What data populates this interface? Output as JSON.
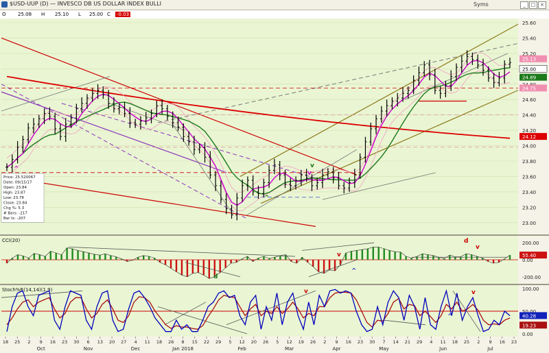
{
  "window": {
    "title": "$USD-UUP (D) — INVESCO DB US DOLLAR INDEX BULLI",
    "brand": "Syms"
  },
  "quote_bar": {
    "items": [
      "O",
      "25.08",
      "H",
      "25.10",
      "L",
      "25.00",
      "C",
      "-0.03"
    ]
  },
  "info_box": [
    "Price: 25.520067",
    "Date: 09/15/17",
    "Open: 23.84",
    "High: 23.87",
    "Low: 23.78",
    "Close: 23.84",
    "Chg %: 5.3",
    "# Bars: -217",
    "Bar Ix: -207"
  ],
  "colors": {
    "price_bg": "#eaf5d3",
    "bar": "#000000",
    "ma_fast": "#cc00cc",
    "ma_mid": "#1b7a1b",
    "ma_slow": "#dd0000",
    "channel": "#8c7a1a",
    "trend_gray": "#707070",
    "dash_purple": "#8833bb",
    "cci_pos": "#1f8a1f",
    "cci_neg": "#cc1111",
    "stoch_k": "#0000bb",
    "stoch_d": "#aa1111"
  },
  "chart_data": [
    {
      "type": "ohlc",
      "series": [
        {
          "name": "UUP",
          "values": [
            23.72,
            23.82,
            23.98,
            24.08,
            24.23,
            24.28,
            24.35,
            24.42,
            24.38,
            24.22,
            24.12,
            24.28,
            24.36,
            24.48,
            24.55,
            24.62,
            24.68,
            24.72,
            24.66,
            24.55,
            24.48,
            24.5,
            24.42,
            24.3,
            24.28,
            24.32,
            24.36,
            24.42,
            24.52,
            24.48,
            24.38,
            24.3,
            24.24,
            24.12,
            24.05,
            23.95,
            23.98,
            23.85,
            23.62,
            23.48,
            23.3,
            23.18,
            23.1,
            23.32,
            23.48,
            23.55,
            23.4,
            23.38,
            23.52,
            23.68,
            23.75,
            23.62,
            23.5,
            23.48,
            23.55,
            23.62,
            23.58,
            23.48,
            23.52,
            23.62,
            23.66,
            23.58,
            23.48,
            23.45,
            23.52,
            23.62,
            23.85,
            24.05,
            24.22,
            24.35,
            24.45,
            24.52,
            24.58,
            24.62,
            24.68,
            24.72,
            24.85,
            24.95,
            25.05,
            24.92,
            24.72,
            24.68,
            24.78,
            24.9,
            25.02,
            25.1,
            25.16,
            25.12,
            25.05,
            24.98,
            24.88,
            24.82,
            24.88,
            25.06,
            25.08
          ]
        }
      ],
      "last_close": 25.06,
      "ylim": [
        22.9,
        25.6
      ],
      "yticks": [
        "25.60",
        "25.40",
        "25.20",
        "25.00",
        "24.80",
        "24.60",
        "24.40",
        "24.20",
        "24.00",
        "23.80",
        "23.60",
        "23.40",
        "23.20",
        "23.00"
      ],
      "price_labels": [
        {
          "text": "25.13",
          "color": "#f08fb0"
        },
        {
          "text": "25.00",
          "color": "#ffffff"
        },
        {
          "text": "24.89",
          "color": "#1b7a1b"
        },
        {
          "text": "24.75",
          "color": "#f08fb0"
        },
        {
          "text": "24.12",
          "color": "#dd0000"
        }
      ],
      "annotations": [
        "v",
        "v",
        "^",
        "^"
      ]
    },
    {
      "type": "area",
      "title": "CCI(20)",
      "ylim": [
        -250,
        250
      ],
      "yticks": [
        "200.00",
        "0.00",
        "-200.00"
      ],
      "values": [
        -40,
        20,
        60,
        45,
        20,
        75,
        60,
        40,
        100,
        80,
        60,
        140,
        130,
        110,
        95,
        80,
        65,
        55,
        70,
        50,
        35,
        10,
        -20,
        -5,
        30,
        50,
        40,
        20,
        -30,
        -60,
        -100,
        -140,
        -180,
        -200,
        -160,
        -150,
        -180,
        -220,
        -200,
        -150,
        -95,
        -40,
        -30,
        10,
        40,
        -20,
        20,
        40,
        15,
        30,
        50,
        60,
        -20,
        -40,
        30,
        -30,
        -80,
        -140,
        -160,
        -120,
        -130,
        -60,
        80,
        100,
        110,
        120,
        130,
        150,
        150,
        130,
        110,
        95,
        90,
        40,
        20,
        40,
        70,
        60,
        50,
        30,
        15,
        55,
        35,
        35,
        70,
        60,
        40,
        20,
        -20,
        -40,
        -30,
        10,
        55
      ],
      "last_value": "55.40",
      "annotations": [
        "d",
        "v",
        "^",
        "d",
        "v"
      ]
    },
    {
      "type": "line",
      "title": "Stoch%R(14,14)(1,9)",
      "ylim": [
        0,
        100
      ],
      "yticks": [
        "100.00",
        "50.00",
        "0.00"
      ],
      "series": [
        {
          "name": "K",
          "values": [
            5,
            60,
            90,
            95,
            60,
            40,
            85,
            90,
            95,
            30,
            10,
            60,
            95,
            90,
            85,
            30,
            10,
            60,
            90,
            95,
            30,
            5,
            10,
            55,
            90,
            95,
            80,
            60,
            35,
            20,
            5,
            5,
            30,
            10,
            20,
            5,
            5,
            30,
            60,
            70,
            90,
            95,
            80,
            85,
            40,
            20,
            70,
            85,
            10,
            60,
            30,
            90,
            20,
            70,
            90,
            40,
            10,
            70,
            20,
            85,
            60,
            95,
            98,
            90,
            95,
            90,
            50,
            20,
            5,
            10,
            60,
            20,
            70,
            95,
            80,
            30,
            85,
            60,
            10,
            80,
            20,
            10,
            60,
            95,
            40,
            90,
            30,
            60,
            80,
            40,
            5,
            10,
            30,
            20,
            50,
            40
          ]
        },
        {
          "name": "D",
          "values": [
            20,
            35,
            55,
            70,
            75,
            60,
            70,
            75,
            80,
            55,
            35,
            45,
            70,
            80,
            80,
            55,
            35,
            45,
            65,
            75,
            55,
            30,
            25,
            40,
            70,
            82,
            80,
            70,
            50,
            35,
            20,
            12,
            18,
            15,
            15,
            12,
            10,
            18,
            38,
            55,
            75,
            85,
            82,
            80,
            60,
            40,
            55,
            65,
            40,
            50,
            45,
            60,
            45,
            55,
            70,
            55,
            35,
            45,
            40,
            60,
            60,
            80,
            90,
            92,
            92,
            90,
            75,
            50,
            25,
            15,
            30,
            28,
            45,
            70,
            78,
            55,
            65,
            62,
            40,
            50,
            38,
            25,
            40,
            65,
            55,
            70,
            50,
            55,
            65,
            52,
            30,
            20,
            22,
            20,
            30,
            35
          ]
        }
      ],
      "last_values": [
        "40.28",
        "19.23"
      ]
    }
  ],
  "x_axis": {
    "day_labels": [
      "18",
      "25",
      "2",
      "9",
      "16",
      "23",
      "30",
      "6",
      "13",
      "20",
      "27",
      "4",
      "11",
      "18",
      "26",
      "8",
      "15",
      "22",
      "29",
      "5",
      "12",
      "20",
      "26",
      "5",
      "12",
      "19",
      "26",
      "2",
      "9",
      "16",
      "23",
      "30",
      "7",
      "14",
      "21",
      "29",
      "4",
      "11",
      "18",
      "25",
      "2",
      "9",
      "16",
      "23"
    ],
    "month_labels": [
      "Oct",
      "Nov",
      "Dec",
      "Jan 2018",
      "Feb",
      "Mar",
      "Apr",
      "May",
      "Jun",
      "Jul"
    ]
  }
}
